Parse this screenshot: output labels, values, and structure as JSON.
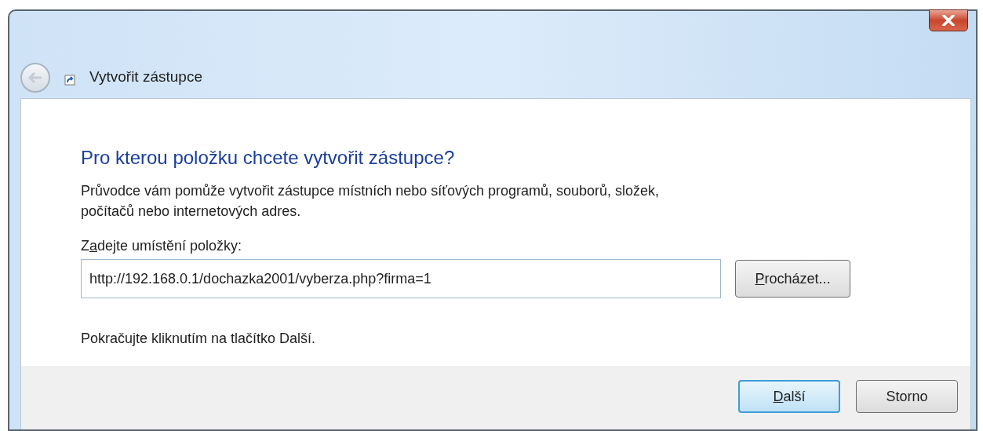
{
  "window": {
    "title": "Vytvořit zástupce"
  },
  "heading": "Pro kterou položku chcete vytvořit zástupce?",
  "description": "Průvodce vám pomůže vytvořit zástupce místních nebo síťových programů, souborů, složek, počítačů nebo internetových adres.",
  "location_label": {
    "before": "Z",
    "key": "a",
    "after": "dejte umístění položky:"
  },
  "location_field": {
    "value": "http://192.168.0.1/dochazka2001/vyberza.php?firma=1"
  },
  "browse_button": {
    "key": "P",
    "after": "rocházet..."
  },
  "hint": "Pokračujte kliknutím na tlačítko Další.",
  "buttons": [
    {
      "key": "D",
      "after": "alší",
      "default": true
    },
    {
      "before": "Storno",
      "default": false
    }
  ]
}
